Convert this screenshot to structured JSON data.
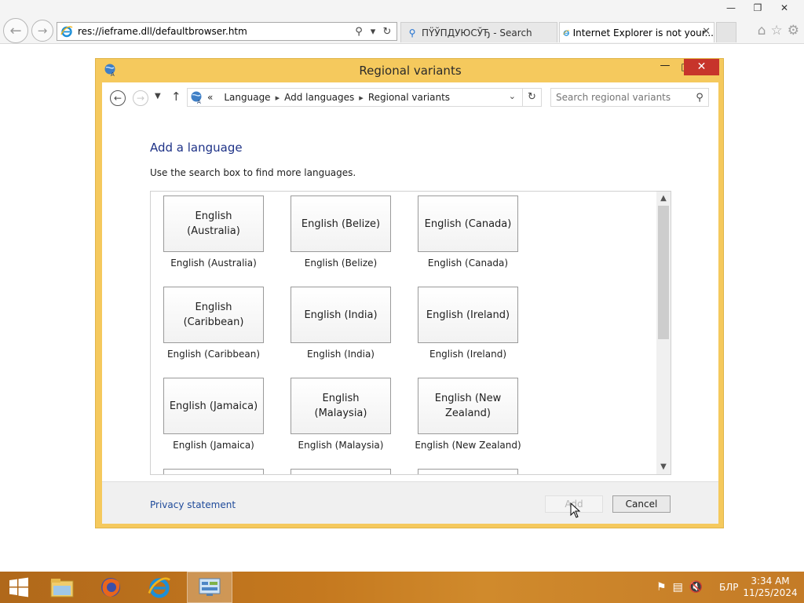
{
  "browser": {
    "address": "res://ieframe.dll/defaultbrowser.htm",
    "tabs": [
      {
        "label": "ПŸЎПДУЮСЎЂ - Search"
      },
      {
        "label": "Internet Explorer is not your..."
      }
    ]
  },
  "dialog": {
    "title": "Regional variants",
    "breadcrumb": [
      "Language",
      "Add languages",
      "Regional variants"
    ],
    "breadcrumb_prefix": "«",
    "search_placeholder": "Search regional variants",
    "heading": "Add a language",
    "instruction": "Use the search box to find more languages.",
    "languages": [
      {
        "tile": "English (Australia)",
        "caption": "English (Australia)"
      },
      {
        "tile": "English (Belize)",
        "caption": "English (Belize)"
      },
      {
        "tile": "English (Canada)",
        "caption": "English (Canada)"
      },
      {
        "tile": "English (Caribbean)",
        "caption": "English (Caribbean)"
      },
      {
        "tile": "English (India)",
        "caption": "English (India)"
      },
      {
        "tile": "English (Ireland)",
        "caption": "English (Ireland)"
      },
      {
        "tile": "English (Jamaica)",
        "caption": "English (Jamaica)"
      },
      {
        "tile": "English (Malaysia)",
        "caption": "English (Malaysia)"
      },
      {
        "tile": "English (New Zealand)",
        "caption": "English (New Zealand)"
      }
    ],
    "privacy_link": "Privacy statement",
    "add_label": "Add",
    "cancel_label": "Cancel"
  },
  "taskbar": {
    "language": "БЛР",
    "time": "3:34 AM",
    "date": "11/25/2024"
  }
}
